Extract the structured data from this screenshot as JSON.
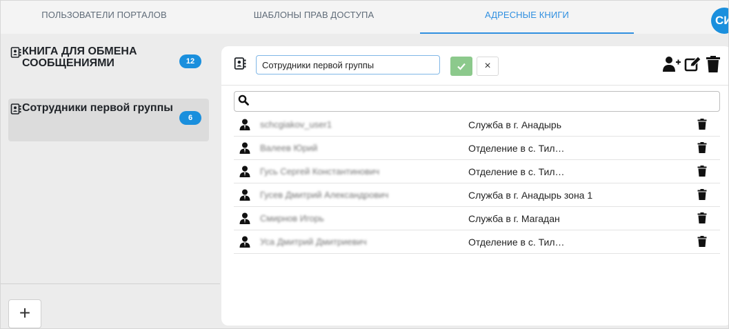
{
  "tabs": [
    {
      "label": "ПОЛЬЗОВАТЕЛИ ПОРТАЛОВ"
    },
    {
      "label": "ШАБЛОНЫ ПРАВ ДОСТУПА"
    },
    {
      "label": "АДРЕСНЫЕ КНИГИ"
    }
  ],
  "active_tab": "АДРЕСНЫЕ КНИГИ",
  "avatar_initials": "СИ",
  "books": [
    {
      "icon": "address-book-icon",
      "title": "КНИГА ДЛЯ ОБМЕНА СООБЩЕНИЯМИ",
      "count": "12"
    },
    {
      "icon": "address-book-icon",
      "title": "Сотрудники первой группы",
      "count": "6"
    }
  ],
  "add_button_label": "+",
  "editor": {
    "name_value": "Сотрудники первой группы",
    "confirm_icon": "check-icon",
    "cancel_label": "×"
  },
  "header_actions": [
    "add-user-icon",
    "edit-icon",
    "trash-icon"
  ],
  "search": {
    "icon": "search-icon",
    "value": ""
  },
  "members": [
    {
      "name": "schcgiakov_user1",
      "unit": "Служба в г. Анадырь"
    },
    {
      "name": "Валеев Юрий",
      "unit": "Отделение в с. Тил…"
    },
    {
      "name": "Гусь Сергей Константинович",
      "unit": "Отделение в с. Тил…"
    },
    {
      "name": "Гусев Дмитрий Александрович",
      "unit": "Служба в г. Анадырь  зона 1"
    },
    {
      "name": "Смирнов Игорь",
      "unit": "Служба в г. Магадан"
    },
    {
      "name": "Уса Дмитрий Дмитриевич",
      "unit": "Отделение в с. Тил…"
    }
  ],
  "colors": {
    "accent": "#1a8fdd",
    "confirm": "#8cc98c",
    "tab_active": "#2f8fe0"
  }
}
